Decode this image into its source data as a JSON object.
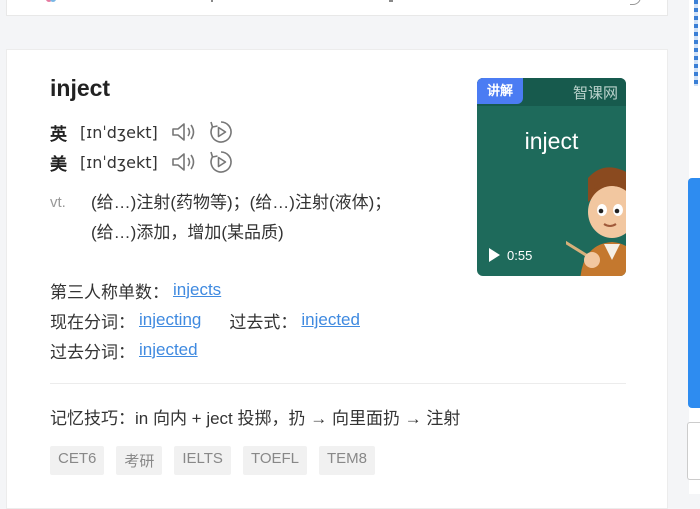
{
  "entry": {
    "word": "inject",
    "pronunciations": [
      {
        "region": "英",
        "ipa": "[ɪnˈdʒekt]"
      },
      {
        "region": "美",
        "ipa": "[ɪnˈdʒekt]"
      }
    ],
    "definition": {
      "pos": "vt.",
      "lines": [
        "(给…)注射(药物等)；(给…)注射(液体)；",
        "(给…)添加，增加(某品质)"
      ]
    },
    "forms": {
      "third_person_label": "第三人称单数：",
      "third_person": "injects",
      "present_participle_label": "现在分词：",
      "present_participle": "injecting",
      "past_tense_label": "过去式：",
      "past_tense": "injected",
      "past_participle_label": "过去分词：",
      "past_participle": "injected"
    },
    "memory_tip": "记忆技巧：in 向内 + ject 投掷，扔 → 向里面扔 → 注射",
    "tags": [
      "CET6",
      "考研",
      "IELTS",
      "TOEFL",
      "TEM8"
    ]
  },
  "video": {
    "badge": "讲解",
    "brand": "智课网",
    "word": "inject",
    "duration": "0:55"
  },
  "colors": {
    "link": "#3f8ae0",
    "video_bg": "#1e6a5b",
    "badge_bg": "#4b7cf3",
    "side_blue": "#2e8cf0"
  }
}
